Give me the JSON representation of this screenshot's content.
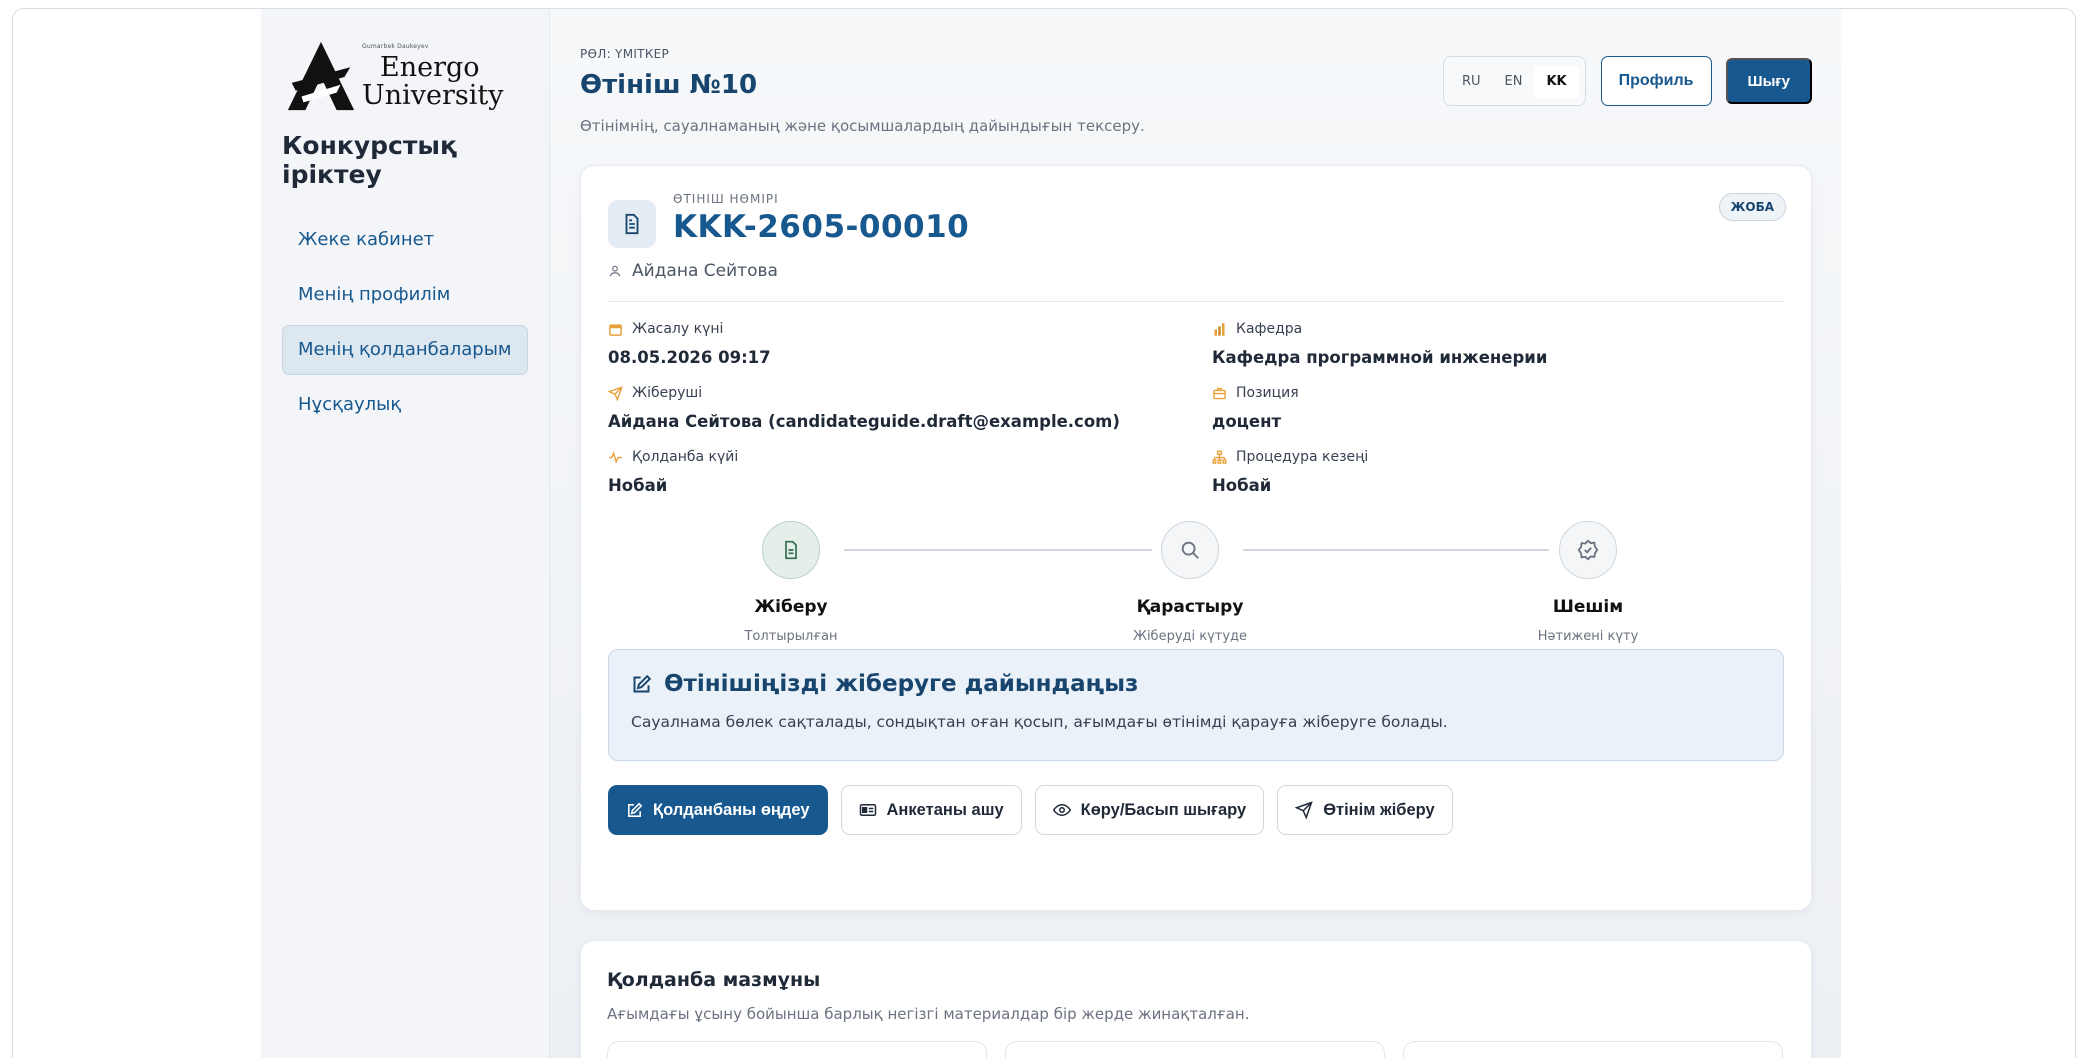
{
  "brand": {
    "small_text": "Gumarbek Daukeyev",
    "word1": "Energo",
    "word2": "University",
    "section_title": "Конкурстық іріктеу"
  },
  "sidebar": {
    "items": [
      {
        "label": "Жеке кабинет"
      },
      {
        "label": "Менің профилім"
      },
      {
        "label": "Менің қолданбаларым",
        "active": true
      },
      {
        "label": "Нұсқаулық"
      }
    ]
  },
  "header": {
    "role": "РӨЛ: ҮМІТКЕР",
    "title": "Өтініш №10",
    "subtitle": "Өтінімнің, сауалнаманың және қосымшалардың дайындығын тексеру.",
    "languages": [
      "RU",
      "EN",
      "KK"
    ],
    "active_language": "KK",
    "profile_button": "Профиль",
    "logout_button": "Шығу"
  },
  "application": {
    "label": "ӨТІНІШ НӨМІРІ",
    "number": "KKK-2605-00010",
    "status_badge": "ЖОБА",
    "owner": "Айдана Сейтова",
    "fields": {
      "created_label": "Жасалу күні",
      "created_value": "08.05.2026 09:17",
      "department_label": "Кафедра",
      "department_value": "Кафедра программной инженерии",
      "sender_label": "Жіберуші",
      "sender_value": "Айдана Сейтова (candidateguide.draft@example.com)",
      "position_label": "Позиция",
      "position_value": "доцент",
      "status_label": "Қолданба күйі",
      "status_value": "Нобай",
      "stage_label": "Процедура кезеңі",
      "stage_value": "Нобай"
    },
    "steps": [
      {
        "title": "Жіберу",
        "subtitle": "Толтырылған"
      },
      {
        "title": "Қарастыру",
        "subtitle": "Жіберуді күтуде"
      },
      {
        "title": "Шешім",
        "subtitle": "Нәтижені күту"
      }
    ],
    "alert": {
      "title": "Өтінішіңізді жіберуге дайындаңыз",
      "text": "Сауалнама бөлек сақталады, сондықтан оған қосып, ағымдағы өтінімді қарауға жіберуге болады."
    },
    "actions": {
      "edit": "Қолданбаны өңдеу",
      "open_form": "Анкетаны ашу",
      "view_print": "Көру/Басып шығару",
      "submit": "Өтінім жіберу"
    }
  },
  "contents": {
    "title": "Қолданба мазмұны",
    "subtitle": "Ағымдағы ұсыну бойынша барлық негізгі материалдар бір жерде жинақталған."
  },
  "colors": {
    "brand": "#17588f",
    "title": "#17456e",
    "alert_bg": "#eaf1f8",
    "accent_orange": "#e8a13a"
  }
}
